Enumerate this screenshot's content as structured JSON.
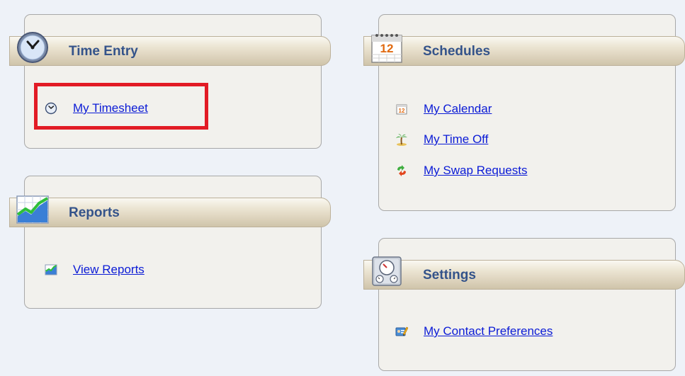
{
  "panels": {
    "time_entry": {
      "title": "Time Entry",
      "links": [
        {
          "label": "My Timesheet",
          "icon": "clock-icon"
        }
      ]
    },
    "reports": {
      "title": "Reports",
      "links": [
        {
          "label": "View Reports",
          "icon": "chart-icon"
        }
      ]
    },
    "schedules": {
      "title": "Schedules",
      "calendar_number": "12",
      "links": [
        {
          "label": "My Calendar",
          "icon": "calendar-icon"
        },
        {
          "label": "My Time Off",
          "icon": "palm-tree-icon"
        },
        {
          "label": "My Swap Requests",
          "icon": "swap-arrows-icon"
        }
      ]
    },
    "settings": {
      "title": "Settings",
      "links": [
        {
          "label": "My Contact Preferences",
          "icon": "contact-card-icon"
        }
      ]
    }
  },
  "colors": {
    "highlight": "#e21b25",
    "title": "#34538a",
    "link": "#0b1bd6"
  }
}
